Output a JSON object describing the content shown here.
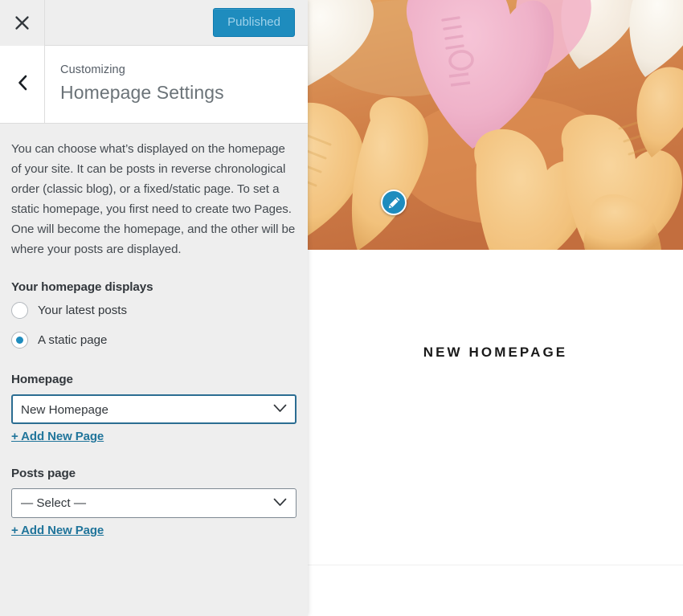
{
  "customizer": {
    "close_icon": "close-x-icon",
    "back_icon": "chevron-left-icon",
    "publish_label": "Published",
    "eyebrow": "Customizing",
    "panel_title": "Homepage Settings",
    "description": "You can choose what’s displayed on the homepage of your site. It can be posts in reverse chronological order (classic blog), or a fixed/static page. To set a static homepage, you first need to create two Pages. One will become the homepage, and the other will be where your posts are displayed.",
    "display_heading": "Your homepage displays",
    "radios": [
      {
        "label": "Your latest posts",
        "checked": false
      },
      {
        "label": "A static page",
        "checked": true
      }
    ],
    "homepage_field": {
      "heading": "Homepage",
      "selected": "New Homepage",
      "options": [
        "— Select —",
        "New Homepage"
      ],
      "add_link": "+ Add New Page",
      "chevron_icon": "chevron-down-icon",
      "focused": true
    },
    "posts_page_field": {
      "heading": "Posts page",
      "selected": "— Select —",
      "options": [
        "— Select —",
        "New Homepage"
      ],
      "add_link": "+ Add New Page",
      "chevron_icon": "chevron-down-icon",
      "focused": false
    }
  },
  "preview": {
    "header_image_alt": "candy conversation hearts",
    "edit_shortcut_icon": "pencil-edit-icon",
    "entry_title": "NEW HOMEPAGE"
  },
  "colors": {
    "accent_blue": "#1e8cbe",
    "link_blue": "#21759b",
    "sidebar_bg": "#eeeeee",
    "heading_text": "#32373c",
    "body_text": "#444a50",
    "focus_border": "#2b6d92"
  }
}
